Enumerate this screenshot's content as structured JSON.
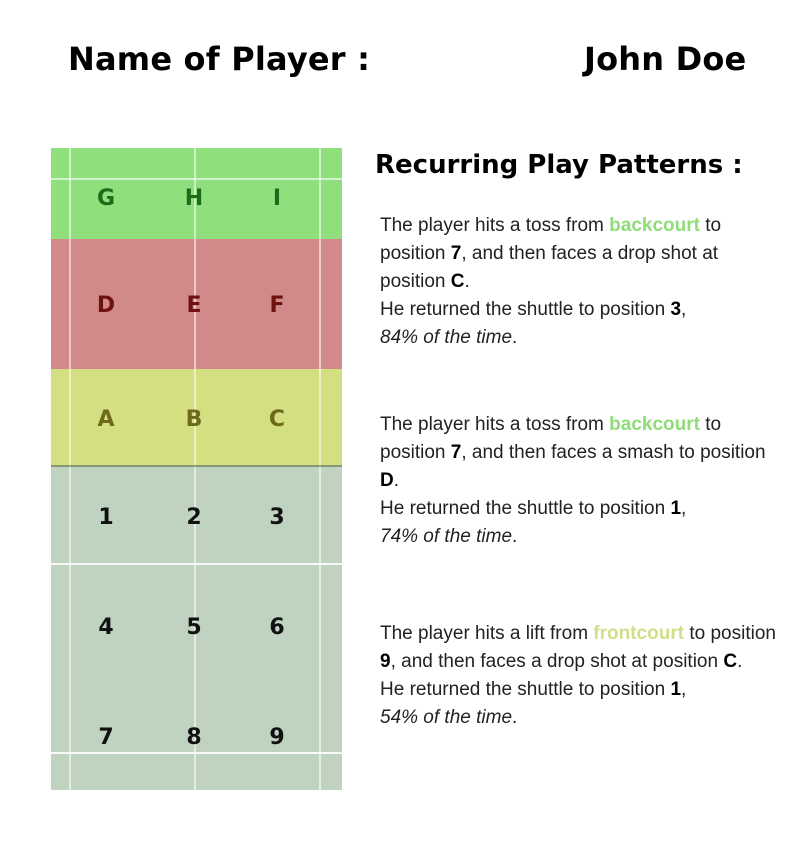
{
  "header": {
    "name_label": "Name of Player :",
    "player_name": "John Doe"
  },
  "court": {
    "colors": {
      "back_zone": "#8fe07c",
      "mid_zone": "#d2898a",
      "net_zone": "#d3df80",
      "grid_zone": "#c0d3c0",
      "back_text": "#1b6d1b",
      "mid_text": "#6e1111",
      "net_text": "#6e6a1c",
      "grid_text": "#111111"
    },
    "rows": [
      {
        "zone": "back",
        "labels": [
          "G",
          "H",
          "I"
        ]
      },
      {
        "zone": "mid",
        "labels": [
          "D",
          "E",
          "F"
        ]
      },
      {
        "zone": "net",
        "labels": [
          "A",
          "B",
          "C"
        ]
      },
      {
        "zone": "grid",
        "labels": [
          "1",
          "2",
          "3"
        ]
      },
      {
        "zone": "grid",
        "labels": [
          "4",
          "5",
          "6"
        ]
      },
      {
        "zone": "grid",
        "labels": [
          "7",
          "8",
          "9"
        ]
      }
    ]
  },
  "patterns_title": "Recurring Play Patterns :",
  "patterns": [
    {
      "p1": "The player hits a toss from ",
      "court_area": "backcourt",
      "area_color": "#8fdc78",
      "p2": " to position ",
      "from_pos": "7",
      "p3": ", and then faces a ",
      "shot": "drop shot",
      "p4": " at position ",
      "zone": "C",
      "p5": ".",
      "p6": "He returned the shuttle to position ",
      "return_pos": "3",
      "p7": ",",
      "percent": "84% of the time",
      "p8": "."
    },
    {
      "p1": "The player hits a toss from ",
      "court_area": "backcourt",
      "area_color": "#8fdc78",
      "p2": " to position ",
      "from_pos": "7",
      "p3": ", and then faces a ",
      "shot": "smash",
      "p4": " to position ",
      "zone": "D",
      "p5": ".",
      "p6": "He returned the shuttle to position ",
      "return_pos": "1",
      "p7": ",",
      "percent": "74% of the time",
      "p8": "."
    },
    {
      "p1": "The player hits a lift from ",
      "court_area": "frontcourt",
      "area_color": "#cfdf8a",
      "p2": " to position ",
      "from_pos": "9",
      "p3": ", and then faces a ",
      "shot": "drop shot",
      "p4": " at position ",
      "zone": "C",
      "p5": ".",
      "p6": "He returned the shuttle to position ",
      "return_pos": "1",
      "p7": ",",
      "percent": "54% of the time",
      "p8": "."
    }
  ]
}
